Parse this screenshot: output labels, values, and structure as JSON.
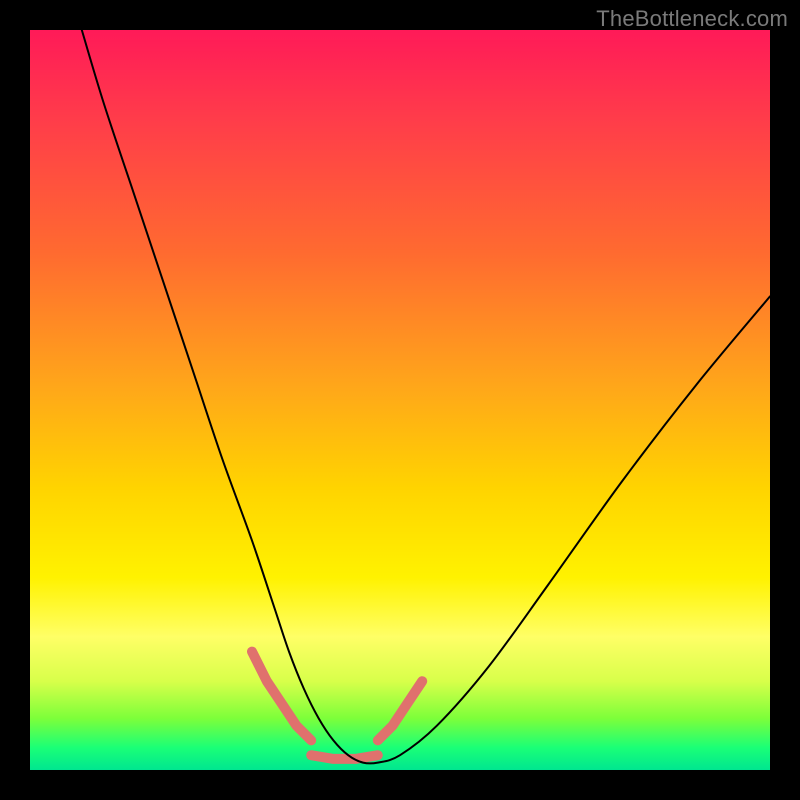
{
  "watermark": "TheBottleneck.com",
  "chart_data": {
    "type": "line",
    "title": "",
    "xlabel": "",
    "ylabel": "",
    "xlim": [
      0,
      100
    ],
    "ylim": [
      0,
      100
    ],
    "series": [
      {
        "name": "bottleneck-curve",
        "color": "#000000",
        "width": 2,
        "x": [
          7,
          10,
          14,
          18,
          22,
          26,
          30,
          33,
          35,
          37,
          39,
          41,
          43,
          45,
          47,
          50,
          55,
          62,
          70,
          80,
          90,
          100
        ],
        "y": [
          100,
          90,
          78,
          66,
          54,
          42,
          31,
          22,
          16,
          11,
          7,
          4,
          2,
          1,
          1,
          2,
          6,
          14,
          25,
          39,
          52,
          64
        ]
      },
      {
        "name": "highlight-segments",
        "color": "#e0716d",
        "width": 10,
        "segments": [
          {
            "x": [
              30,
              32,
              34,
              36,
              38
            ],
            "y": [
              16,
              12,
              9,
              6,
              4
            ]
          },
          {
            "x": [
              38,
              41,
              44,
              47
            ],
            "y": [
              2,
              1.5,
              1.5,
              2
            ]
          },
          {
            "x": [
              47,
              49,
              51,
              53
            ],
            "y": [
              4,
              6,
              9,
              12
            ]
          }
        ]
      }
    ],
    "background_gradient": {
      "stops": [
        {
          "pos": 0,
          "color": "#ff1a58"
        },
        {
          "pos": 30,
          "color": "#ff6a30"
        },
        {
          "pos": 62,
          "color": "#ffd400"
        },
        {
          "pos": 82,
          "color": "#ffff66"
        },
        {
          "pos": 100,
          "color": "#00e690"
        }
      ]
    }
  }
}
